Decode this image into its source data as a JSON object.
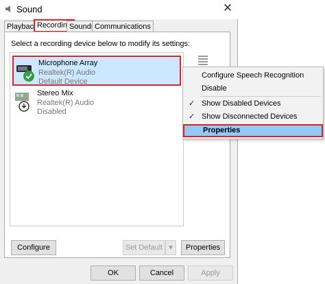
{
  "window": {
    "title": "Sound"
  },
  "tabs": [
    {
      "label": "Playback"
    },
    {
      "label": "Recording"
    },
    {
      "label": "Sounds"
    },
    {
      "label": "Communications"
    }
  ],
  "instruction": "Select a recording device below to modify its settings:",
  "devices": [
    {
      "name": "Microphone Array",
      "driver": "Realtek(R) Audio",
      "status": "Default Device"
    },
    {
      "name": "Stereo Mix",
      "driver": "Realtek(R) Audio",
      "status": "Disabled"
    }
  ],
  "buttons": {
    "configure": "Configure",
    "set_default": "Set Default",
    "properties": "Properties",
    "ok": "OK",
    "cancel": "Cancel",
    "apply": "Apply"
  },
  "context_menu": {
    "items": [
      {
        "label": "Configure Speech Recognition",
        "checked": false
      },
      {
        "label": "Disable",
        "checked": false
      },
      {
        "label": "Show Disabled Devices",
        "checked": true
      },
      {
        "label": "Show Disconnected Devices",
        "checked": true
      },
      {
        "label": "Properties",
        "highlighted": true
      }
    ]
  },
  "colors": {
    "highlight_border": "#d8232a",
    "selection": "#cce8ff",
    "menu_highlight": "#91c9f7"
  }
}
